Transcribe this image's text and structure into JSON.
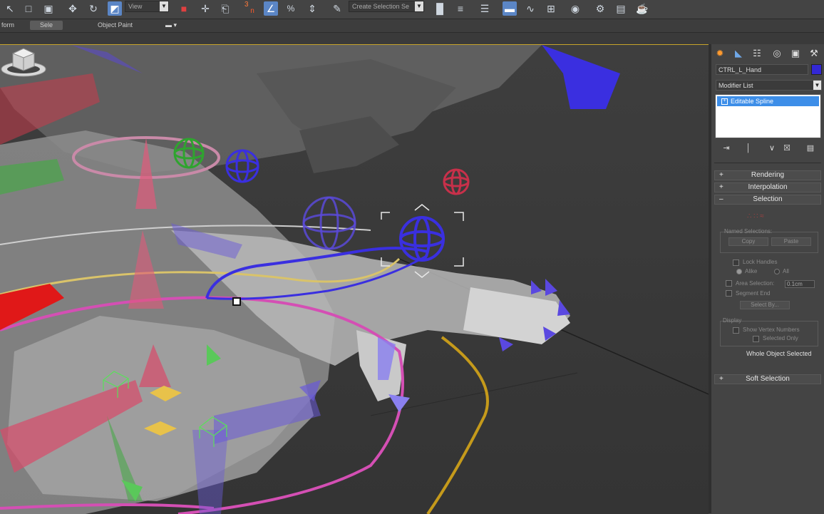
{
  "toolbar": {
    "view_dropdown": "View",
    "snap_label": "3",
    "angle_snap_label": "",
    "percent_snap_label": "%",
    "selection_set_placeholder": "Create Selection Se",
    "icons": [
      "select-object-icon",
      "select-region-icon",
      "window-crossing-icon",
      "select-move-icon",
      "select-rotate-icon",
      "select-scale-icon",
      "reference-coordinate-icon",
      "pivot-center-icon",
      "select-manipulate-icon",
      "keyboard-shortcut-icon",
      "snaps-toggle-icon",
      "angle-snap-icon",
      "percent-snap-icon",
      "spinner-snap-icon",
      "edit-named-selection-icon",
      "mirror-icon",
      "align-icon",
      "layer-manager-icon",
      "ribbon-icon",
      "curve-editor-icon",
      "schematic-view-icon",
      "material-editor-icon",
      "render-setup-icon",
      "rendered-frame-icon",
      "render-teapot-icon"
    ]
  },
  "ribbon": {
    "tabs": [
      "form",
      "Sele",
      "Object Paint"
    ]
  },
  "panel": {
    "tabs": [
      "create-icon",
      "modify-icon",
      "hierarchy-icon",
      "motion-icon",
      "display-icon",
      "utilities-icon"
    ],
    "object_name": "CTRL_L_Hand",
    "object_color": "#3328d4",
    "modifier_list": "Modifier List",
    "stack_item": "Editable Spline",
    "rollouts": {
      "rendering": "Rendering",
      "interpolation": "Interpolation",
      "selection": "Selection",
      "soft_selection": "Soft Selection"
    },
    "selection": {
      "named_selections": "Named Selections:",
      "copy": "Copy",
      "paste": "Paste",
      "lock_handles": "Lock Handles",
      "alike": "Alike",
      "all": "All",
      "area_selection": "Area Selection:",
      "area_value": "0.1cm",
      "segment_end": "Segment End",
      "select_by": "Select By...",
      "display": "Display",
      "show_vertex_numbers": "Show Vertex Numbers",
      "selected_only": "Selected Only",
      "status": "Whole Object Selected"
    }
  }
}
